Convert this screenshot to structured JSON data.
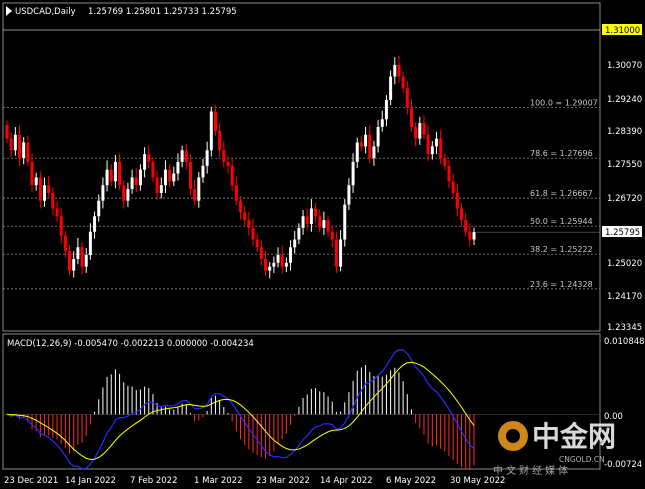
{
  "header": {
    "symbol_timeframe": "USDCAD,Daily",
    "ohlc": "1.25769 1.25801 1.25733 1.25795"
  },
  "macd_panel": {
    "label": "MACD(12,26,9) -0.005470 -0.002213 0.000000 -0.004234"
  },
  "price_axis": {
    "top_marker": "1.31000",
    "current_price": "1.25795",
    "ticks": [
      "1.30070",
      "1.29240",
      "1.28390",
      "1.27550",
      "1.26720",
      "1.25870",
      "1.25020",
      "1.24170",
      "1.23345"
    ]
  },
  "macd_axis": {
    "ticks": [
      "0.010848",
      "0.00",
      "-0.00724"
    ]
  },
  "fibonacci": [
    {
      "label": "100.0 = 1.29007",
      "value": 1.29007
    },
    {
      "label": "78.6 = 1.27696",
      "value": 1.27696
    },
    {
      "label": "61.8 = 1.26667",
      "value": 1.26667
    },
    {
      "label": "50.0 = 1.25944",
      "value": 1.25944
    },
    {
      "label": "38.2 = 1.25222",
      "value": 1.25222
    },
    {
      "label": "23.6 = 1.24328",
      "value": 1.24328
    }
  ],
  "date_axis": [
    "23 Dec 2021",
    "14 Jan 2022",
    "7 Feb 2022",
    "1 Mar 2022",
    "23 Mar 2022",
    "14 Apr 2022",
    "6 May 2022",
    "30 May 2022"
  ],
  "watermark": {
    "title": "中金网",
    "site": "CNGOLD.CN",
    "subtitle": "中文财经媒体"
  },
  "colors": {
    "background": "#000000",
    "bull": "#ffffff",
    "bear": "#ff0000",
    "macd_line": "#0000ff",
    "signal_line": "#ffff00",
    "grid": "#7f7f7f",
    "price_label_bg": "#ffff00"
  },
  "chart_data": {
    "type": "candlestick",
    "instrument": "USDCAD",
    "timeframe": "Daily",
    "price_range": [
      1.23345,
      1.31
    ],
    "fib_levels": [
      1.29007,
      1.27696,
      1.26667,
      1.25944,
      1.25222,
      1.24328
    ],
    "closes": [
      1.282,
      1.279,
      1.283,
      1.277,
      1.281,
      1.276,
      1.27,
      1.272,
      1.266,
      1.27,
      1.268,
      1.264,
      1.262,
      1.257,
      1.253,
      1.248,
      1.251,
      1.254,
      1.249,
      1.252,
      1.258,
      1.262,
      1.266,
      1.27,
      1.274,
      1.271,
      1.276,
      1.27,
      1.266,
      1.269,
      1.272,
      1.27,
      1.274,
      1.278,
      1.276,
      1.272,
      1.268,
      1.27,
      1.274,
      1.271,
      1.273,
      1.276,
      1.279,
      1.276,
      1.269,
      1.266,
      1.272,
      1.275,
      1.279,
      1.289,
      1.284,
      1.279,
      1.276,
      1.275,
      1.27,
      1.266,
      1.263,
      1.261,
      1.259,
      1.256,
      1.254,
      1.251,
      1.248,
      1.249,
      1.25,
      1.252,
      1.249,
      1.25,
      1.254,
      1.256,
      1.259,
      1.262,
      1.26,
      1.264,
      1.262,
      1.259,
      1.261,
      1.258,
      1.256,
      1.249,
      1.256,
      1.265,
      1.27,
      1.276,
      1.281,
      1.28,
      1.283,
      1.277,
      1.28,
      1.285,
      1.287,
      1.292,
      1.298,
      1.301,
      1.298,
      1.295,
      1.29,
      1.285,
      1.282,
      1.286,
      1.283,
      1.278,
      1.28,
      1.282,
      1.277,
      1.275,
      1.271,
      1.268,
      1.264,
      1.261,
      1.258,
      1.256,
      1.2579
    ],
    "macd": {
      "main": -0.00547,
      "signal": -0.002213,
      "other": 0.0,
      "histogram": -0.004234,
      "range": [
        -0.00724,
        0.010848
      ]
    }
  }
}
